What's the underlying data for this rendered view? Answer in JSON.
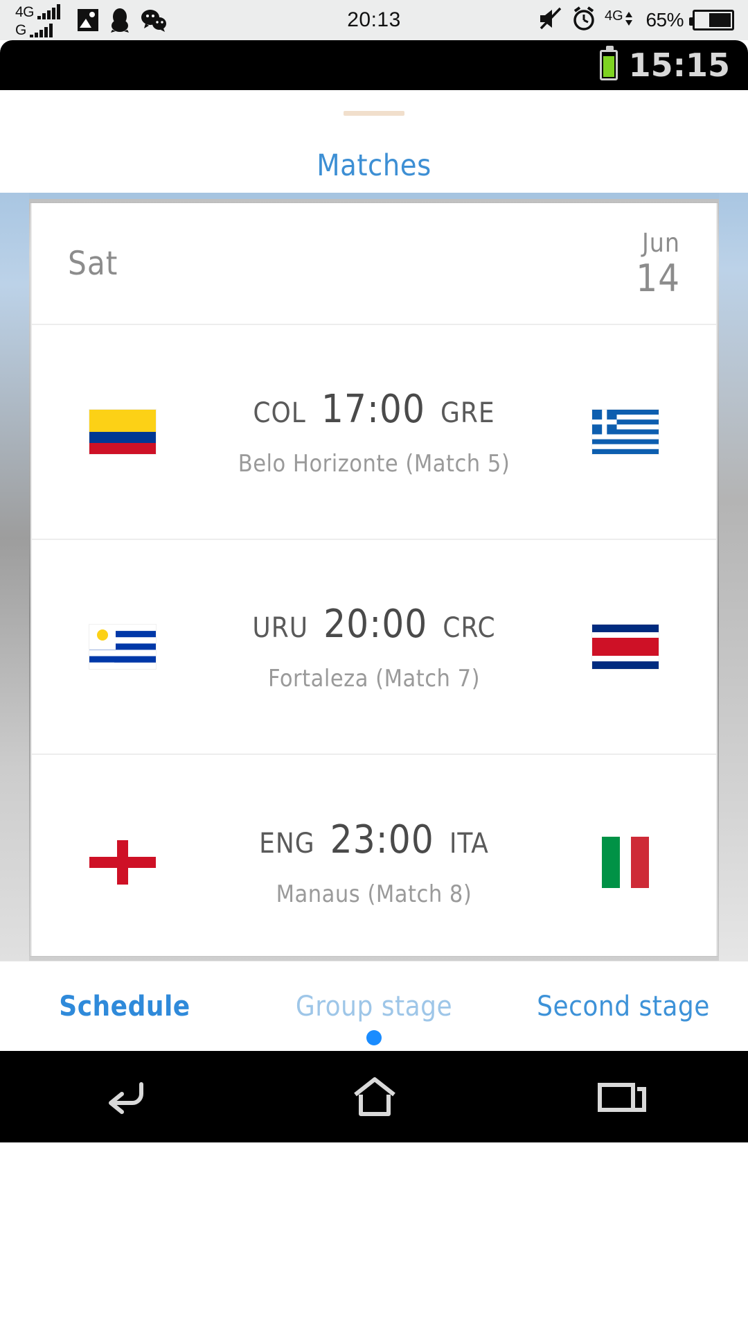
{
  "host_status_bar": {
    "network_primary": "4G",
    "network_secondary": "G",
    "clock": "20:13",
    "battery_percent": "65%",
    "icons": [
      "photo-icon",
      "penguin-icon",
      "wechat-icon",
      "mute-icon",
      "alarm-icon",
      "data-4g-icon",
      "battery-icon"
    ]
  },
  "app_status_bar": {
    "clock": "15:15",
    "battery_icon": "battery-icon"
  },
  "header": {
    "title": "Matches"
  },
  "schedule": {
    "date_header": {
      "day_name": "Sat",
      "month": "Jun",
      "day_number": "14"
    },
    "matches": [
      {
        "home_code": "COL",
        "away_code": "GRE",
        "time": "17:00",
        "venue": "Belo Horizonte (Match  5)",
        "home_flag": "colombia-flag",
        "away_flag": "greece-flag"
      },
      {
        "home_code": "URU",
        "away_code": "CRC",
        "time": "20:00",
        "venue": "Fortaleza (Match  7)",
        "home_flag": "uruguay-flag",
        "away_flag": "costa-rica-flag"
      },
      {
        "home_code": "ENG",
        "away_code": "ITA",
        "time": "23:00",
        "venue": "Manaus (Match  8)",
        "home_flag": "england-flag",
        "away_flag": "italy-flag"
      }
    ]
  },
  "tabs": [
    {
      "label": "Schedule",
      "state": "active"
    },
    {
      "label": "Group stage",
      "state": "dim"
    },
    {
      "label": "Second stage",
      "state": "normal"
    }
  ],
  "nav_bar": {
    "back": "back-icon",
    "home": "home-icon",
    "recents": "recents-icon"
  },
  "colors": {
    "accent_blue": "#2f8ada",
    "title_blue": "#3d8fd4",
    "dot_blue": "#1a8cff",
    "rail_blue": "#a6c4e0",
    "battery_green": "#7ed321"
  }
}
